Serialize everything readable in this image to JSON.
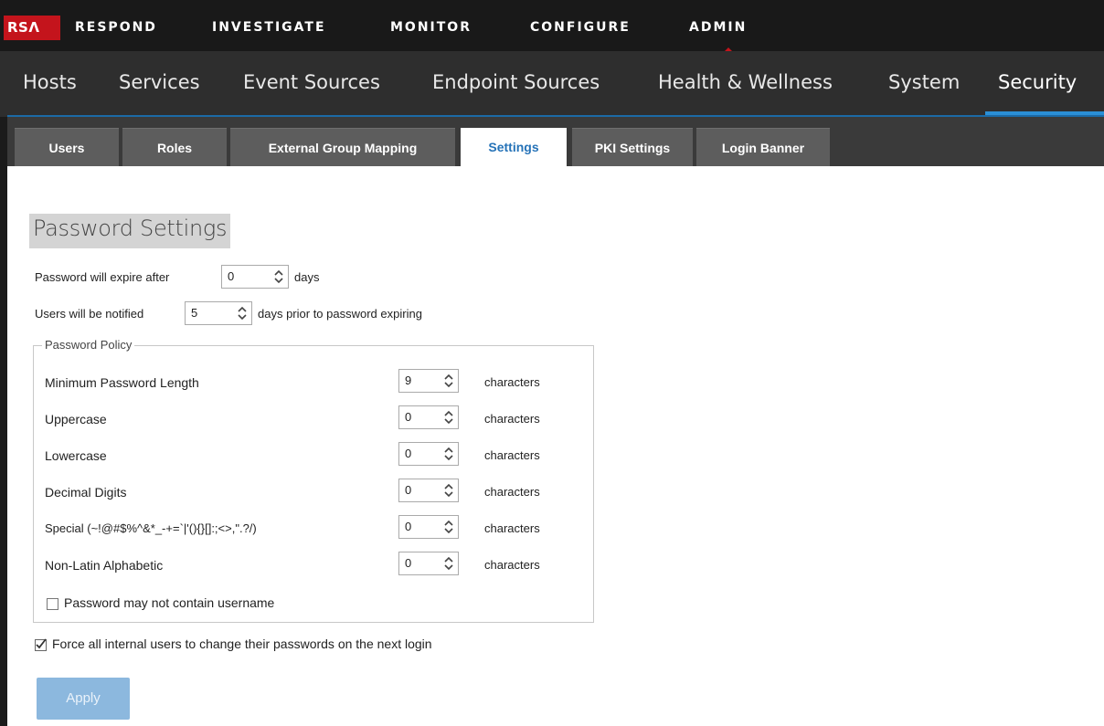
{
  "brand": {
    "logo_text": "RSΛ",
    "accent": "#c4141c"
  },
  "topnav": {
    "items": [
      "RESPOND",
      "INVESTIGATE",
      "MONITOR",
      "CONFIGURE",
      "ADMIN"
    ],
    "active": "ADMIN"
  },
  "subnav": {
    "items": [
      "Hosts",
      "Services",
      "Event Sources",
      "Endpoint Sources",
      "Health & Wellness",
      "System",
      "Security"
    ],
    "active": "Security"
  },
  "tabs": {
    "items": [
      "Users",
      "Roles",
      "External Group Mapping",
      "Settings",
      "PKI Settings",
      "Login Banner"
    ],
    "active": "Settings"
  },
  "page": {
    "title": "Password Settings"
  },
  "expiry": {
    "prefix": "Password will expire after",
    "value": "0",
    "suffix": "days"
  },
  "notify": {
    "prefix": "Users will be notified",
    "value": "5",
    "suffix": "days prior to password expiring"
  },
  "policy": {
    "legend": "Password Policy",
    "unit": "characters",
    "rows": [
      {
        "label": "Minimum Password Length",
        "value": "9"
      },
      {
        "label": "Uppercase",
        "value": "0"
      },
      {
        "label": "Lowercase",
        "value": "0"
      },
      {
        "label": "Decimal Digits",
        "value": "0"
      },
      {
        "label": "Special (~!@#$%^&*_-+=`|'(){}[]:;<>,\".?/)",
        "value": "0"
      },
      {
        "label": "Non-Latin Alphabetic",
        "value": "0"
      }
    ],
    "no_username": {
      "label": "Password may not contain username",
      "checked": false
    }
  },
  "force_change": {
    "label": "Force all internal users to change their passwords on the next login",
    "checked": true
  },
  "apply_label": "Apply"
}
